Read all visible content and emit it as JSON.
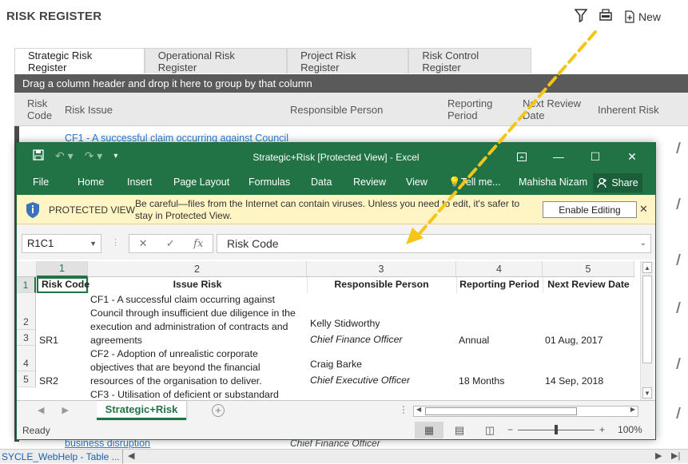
{
  "app": {
    "title": "RISK REGISTER",
    "new_label": "New",
    "filter_icon": "filter-icon",
    "export_icon": "export-icon"
  },
  "tabs": [
    {
      "label": "Strategic Risk Register",
      "active": true
    },
    {
      "label": "Operational Risk Register",
      "active": false
    },
    {
      "label": "Project Risk Register",
      "active": false
    },
    {
      "label": "Risk Control Register",
      "active": false
    }
  ],
  "group_bar": "Drag a column header and drop it here to group by that column",
  "grid_headers": {
    "risk_code": "Risk Code",
    "risk_issue": "Risk Issue",
    "responsible_person": "Responsible Person",
    "reporting_period": "Reporting Period",
    "next_review_date": "Next Review Date",
    "inherent_risk": "Inherent Risk"
  },
  "background_rows": {
    "row1_link": "CF1 - A successful claim occurring against Council",
    "bottom_link": "business disruption",
    "bottom_person": "Chief Finance Officer"
  },
  "taskbar": {
    "item": "SYCLE_WebHelp - Table ..."
  },
  "excel": {
    "title": "Strategic+Risk  [Protected View] - Excel",
    "ribbon": {
      "file": "File",
      "home": "Home",
      "insert": "Insert",
      "page_layout": "Page Layout",
      "formulas": "Formulas",
      "data": "Data",
      "review": "Review",
      "view": "View",
      "tell_me": "Tell me...",
      "user": "Mahisha Nizam",
      "share": "Share"
    },
    "protected_view": {
      "label": "PROTECTED VIEW",
      "message": "Be careful—files from the Internet can contain viruses. Unless you need to edit, it's safer to stay in Protected View.",
      "enable_button": "Enable Editing"
    },
    "formula_bar": {
      "name_box": "R1C1",
      "fx": "fx",
      "value": "Risk Code"
    },
    "columns": [
      "1",
      "2",
      "3",
      "4",
      "5"
    ],
    "rows": [
      "1",
      "2",
      "3",
      "4",
      "5"
    ],
    "cells": {
      "h1": "Risk Code",
      "h2": "Issue Risk",
      "h3": "Responsible Person",
      "h4": "Reporting Period",
      "h5": "Next Review Date",
      "cf1_l1": "CF1 - A successful claim occurring against",
      "cf1_l2": "Council through insufficient due diligence in the",
      "cf1_l3": "execution and administration of contracts and",
      "cf1_l4": "agreements",
      "p1_name": "Kelly Stidworthy",
      "p1_title": "Chief Finance Officer",
      "sr1": "SR1",
      "period1": "Annual",
      "date1": "01 Aug, 2017",
      "cf2_l1": "CF2 - Adoption of unrealistic corporate",
      "cf2_l2": "objectives that are beyond the financial",
      "cf2_l3": "resources of the organisation to deliver.",
      "p2_name": "Craig Barke",
      "p2_title": "Chief Executive Officer",
      "sr2": "SR2",
      "period2": "18 Months",
      "date2": "14 Sep, 2018",
      "cf3_l1": "CF3 - Utilisation of deficient or substandard"
    },
    "sheet_tab": "Strategic+Risk",
    "status": "Ready",
    "zoom": "100%"
  }
}
